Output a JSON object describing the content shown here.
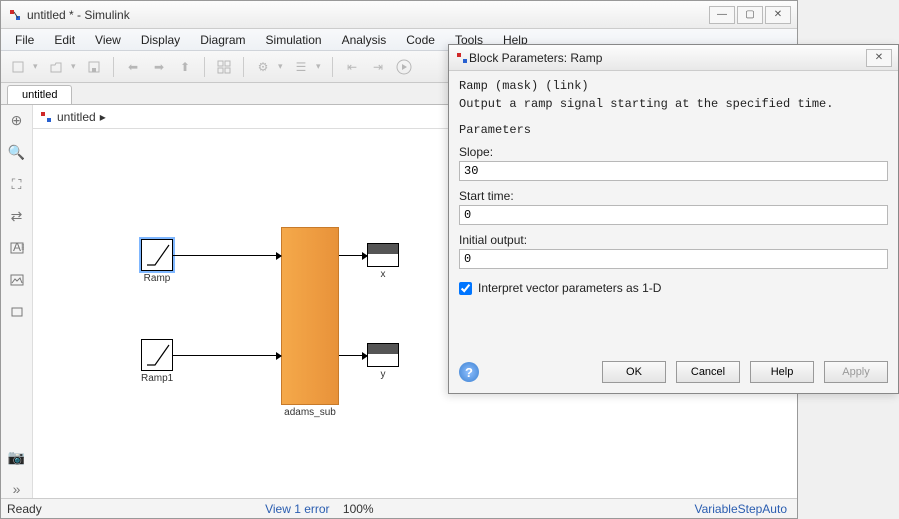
{
  "main": {
    "title": "untitled * - Simulink",
    "menus": [
      "File",
      "Edit",
      "View",
      "Display",
      "Diagram",
      "Simulation",
      "Analysis",
      "Code",
      "Tools",
      "Help"
    ],
    "tab": "untitled",
    "breadcrumb": "untitled",
    "status_left": "Ready",
    "status_error": "View 1 error",
    "status_zoom": "100%",
    "status_solver": "VariableStepAuto"
  },
  "blocks": {
    "ramp_label": "Ramp",
    "ramp1_label": "Ramp1",
    "adams_label": "adams_sub",
    "x_label": "x",
    "y_label": "y"
  },
  "dialog": {
    "title": "Block Parameters: Ramp",
    "masktype": "Ramp (mask) (link)",
    "description": "Output a ramp signal starting at the specified time.",
    "section": "Parameters",
    "slope_label": "Slope:",
    "slope_value": "30",
    "start_label": "Start time:",
    "start_value": "0",
    "init_label": "Initial output:",
    "init_value": "0",
    "interp_label": "Interpret vector parameters as 1-D",
    "interp_checked": true,
    "btn_ok": "OK",
    "btn_cancel": "Cancel",
    "btn_help": "Help",
    "btn_apply": "Apply"
  }
}
